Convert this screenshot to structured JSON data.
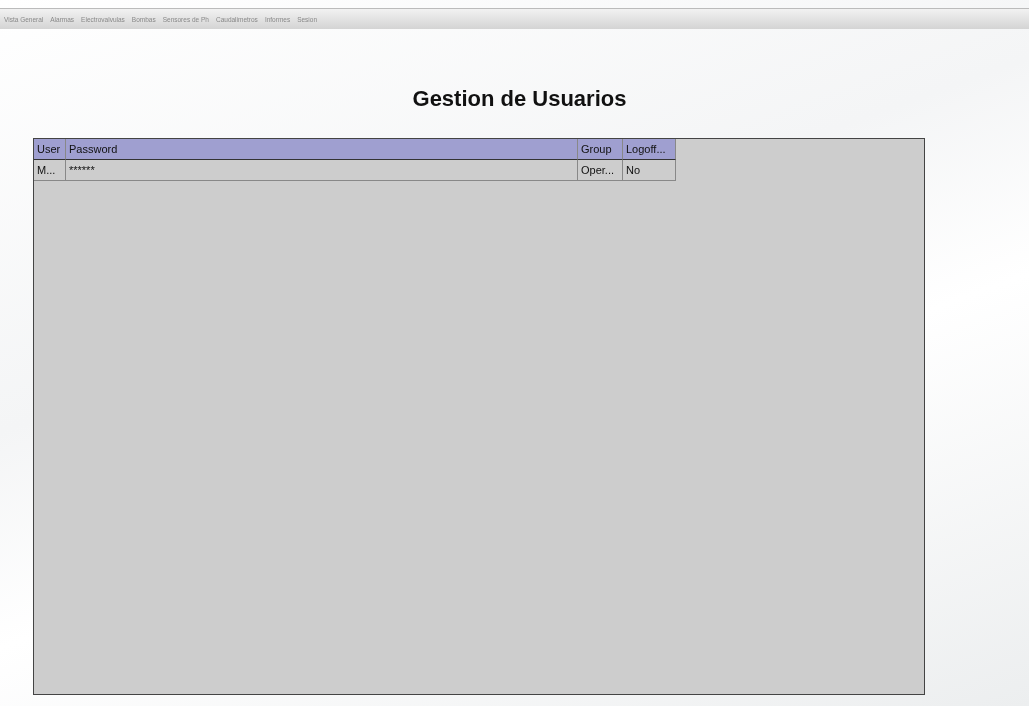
{
  "menu": [
    "Vista General",
    "Alarmas",
    "Electrovalvulas",
    "Bombas",
    "Sensores de Ph",
    "Caudalimetros",
    "Informes",
    "Sesion"
  ],
  "title": "Gestion de Usuarios",
  "table": {
    "columns": [
      "User",
      "Password",
      "Group",
      "Logoff..."
    ],
    "rows": [
      [
        "M...",
        "******",
        "Oper...",
        "No"
      ]
    ]
  }
}
